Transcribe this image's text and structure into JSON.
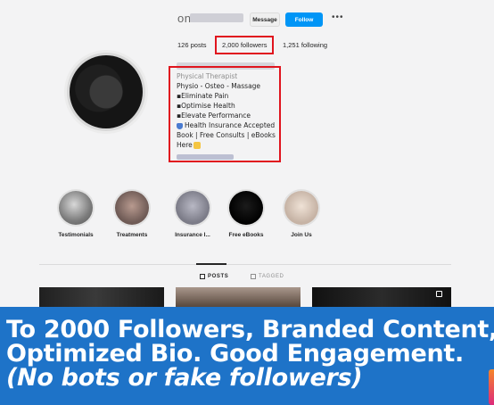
{
  "profile": {
    "username_prefix": "on",
    "message_label": "Message",
    "follow_label": "Follow",
    "more_label": "•••"
  },
  "stats": {
    "posts": "126 posts",
    "followers": "2,000 followers",
    "following": "1,251 following"
  },
  "bio": {
    "category": "Physical Therapist",
    "lines": [
      "Physio - Osteo - Massage",
      "▪Eliminate Pain",
      "▪Optimise Health",
      "▪Elevate Performance",
      "Health Insurance Accepted",
      "Book | Free Consults | eBooks",
      "Here"
    ]
  },
  "highlights": [
    {
      "label": "Testimonials"
    },
    {
      "label": "Treatments"
    },
    {
      "label": "Insurance I..."
    },
    {
      "label": "Free eBooks"
    },
    {
      "label": "Join Us"
    }
  ],
  "tabs": {
    "posts": "POSTS",
    "tagged": "TAGGED"
  },
  "banner": {
    "line1": "To 2000 Followers, Branded Content,",
    "line2": "Optimized Bio. Good Engagement.",
    "line3": "(No bots or fake followers)"
  },
  "colors": {
    "follow_button": "#0095f6",
    "highlight_box": "#e0141e",
    "banner": "#1e73c8"
  }
}
